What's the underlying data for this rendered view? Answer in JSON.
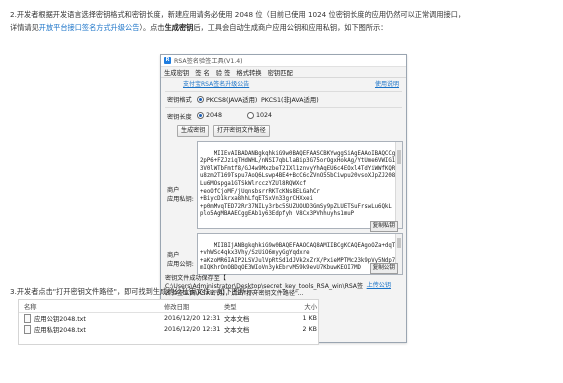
{
  "step2": {
    "text_a": "2.开发者根据开发语言选择密钥格式和密钥长度，新建应用请务必使用 2048 位（目前已使用 1024 位密钥长度的应用仍然可以正常调用接口，",
    "text_b": "详情请见",
    "link": "开放平台接口签名方式升级公告",
    "text_c": "）。点击",
    "bold": "生成密钥",
    "text_d": "后，工具会自动生成商户应用公钥和应用私钥，如下图所示："
  },
  "tool": {
    "title": "RSA签名验签工具(V1.4)",
    "tabs": [
      "生成密钥",
      "签 名",
      "验 签",
      "格式转换",
      "密钥匹配"
    ],
    "link_left": "支付宝RSA签名升级公告",
    "link_right": "使用说明",
    "format_label": "密钥格式",
    "format_opt1": "PKCS8(JAVA适用)",
    "format_opt2": "PKCS1(非JAVA适用)",
    "length_label": "密钥长度",
    "len_opt1": "2048",
    "len_opt2": "1024",
    "btn_generate": "生成密钥",
    "btn_open_path": "打开密钥文件路径",
    "private_label_1": "商户",
    "private_label_2": "应用私钥:",
    "private_key": "MIIEvAIBADANBgkqhkiG9w0BAQEFAASCBKYwggSiAgEAAoIBAQCCgStr5\n2pP6+FZJziqTHdWHL/nNSI7qbLlaBip3G75orOgxHokAg/YtUme6VWIG1J\n3V0lWTbFmtf8/GJ4w9MxzbeT2IXl1znvyYhAqEU6c4EOxl4TdYiWWfKQRu\nu8zm2T169Tspu7AoQ6Lswp4BE4+BcC6cZVnO55bCiwpu20vsoXJpZJ2084\nLu6MOspga1GTSkWlrcczYZUl8RQWXcf\n+eoOfCjoMF/jUqnsbsrrRKTcKNs8ELGahCr\n+BiycD1krxa8hhLfqETSxVn33grCHXxei\n+p0mMvqTED72Rr37NILy3rbc5SUZUOUD3GmSy9pZLUETSuFrswLu6QkL\nplo5AgMBAAECggEAb1y63Edpfyh V8Cx3PVhhuyhs1muP",
    "save_btn": "复制私钥",
    "public_label_1": "商户",
    "public_label_2": "应用公钥:",
    "public_key": "MIIBIjANBgkqhkiG9w0BAQEFAAOCAQ8AMIIBCgKCAQEAgoOZa+dqT\n+vhWSc4qkx3Vhy/SzUiO6myyGgYqdxre\n+aKzoMR6IAIP2LSVJulVpRtSd1dJVk2xZrX/PxieMPTMc23k9pVy5Ndp78\nmIQKhrOnOBDqOE3WIoVn3ykEbrvM59k9evU7KbuwKEOI7MD",
    "copy_btn": "复制公钥",
    "status_line1": "密钥文件成功保存至【",
    "status_line2": "C:\\Users\\Administrator\\Desktop\\secret_key_tools_RSA_win\\RSA签",
    "status_line3": "名验签工具\\RSA密钥】，点击\"打开密钥文件路径\"...",
    "status_link": "上传公钥"
  },
  "step3": {
    "text": "3.开发者点击\"打开密钥文件路径\"，即可找到生成的公私钥文件，如下图所示："
  },
  "filelist": {
    "headers": [
      "名称",
      "修改日期",
      "类型",
      "大小"
    ],
    "rows": [
      [
        "应用公钥2048.txt",
        "2016/12/20 12:31",
        "文本文档",
        "1 KB"
      ],
      [
        "应用私钥2048.txt",
        "2016/12/20 12:31",
        "文本文档",
        "2 KB"
      ]
    ]
  }
}
